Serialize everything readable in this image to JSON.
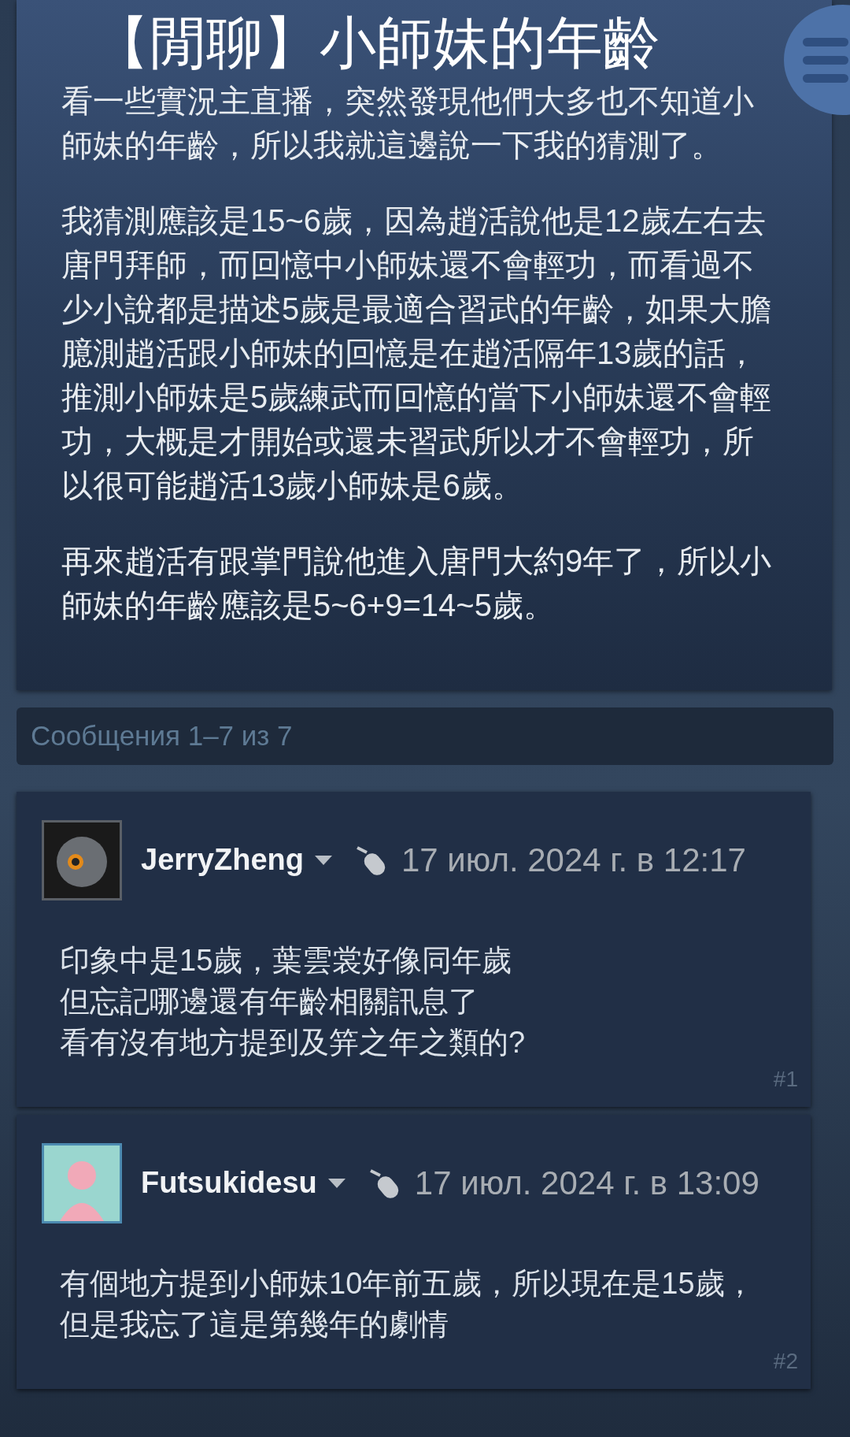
{
  "topic": {
    "title": "【閒聊】小師妹的年齡",
    "paragraphs": [
      "看一些實況主直播，突然發現他們大多也不知道小師妹的年齡，所以我就這邊說一下我的猜測了。",
      "我猜測應該是15~6歲，因為趙活說他是12歲左右去唐門拜師，而回憶中小師妹還不會輕功，而看過不少小說都是描述5歲是最適合習武的年齡，如果大膽臆測趙活跟小師妹的回憶是在趙活隔年13歲的話，推測小師妹是5歲練武而回憶的當下小師妹還不會輕功，大概是才開始或還未習武所以才不會輕功，所以很可能趙活13歲小師妹是6歲。",
      "再來趙活有跟掌門說他進入唐門大約9年了，所以小師妹的年齡應該是5~6+9=14~5歲。"
    ]
  },
  "pagination": {
    "text": "Сообщения 1–7 из 7"
  },
  "posts": [
    {
      "author": "JerryZheng",
      "online": false,
      "date": "17 июл. 2024 г. в 12:17",
      "lines": [
        "印象中是15歲，葉雲裳好像同年歲",
        "但忘記哪邊還有年齡相關訊息了",
        "看有沒有地方提到及笄之年之類的?"
      ],
      "number": "#1"
    },
    {
      "author": "Futsukidesu",
      "online": true,
      "date": "17 июл. 2024 г. в 13:09",
      "lines": [
        "有個地方提到小師妹10年前五歲，所以現在是15歲，",
        "但是我忘了這是第幾年的劇情"
      ],
      "number": "#2"
    }
  ]
}
